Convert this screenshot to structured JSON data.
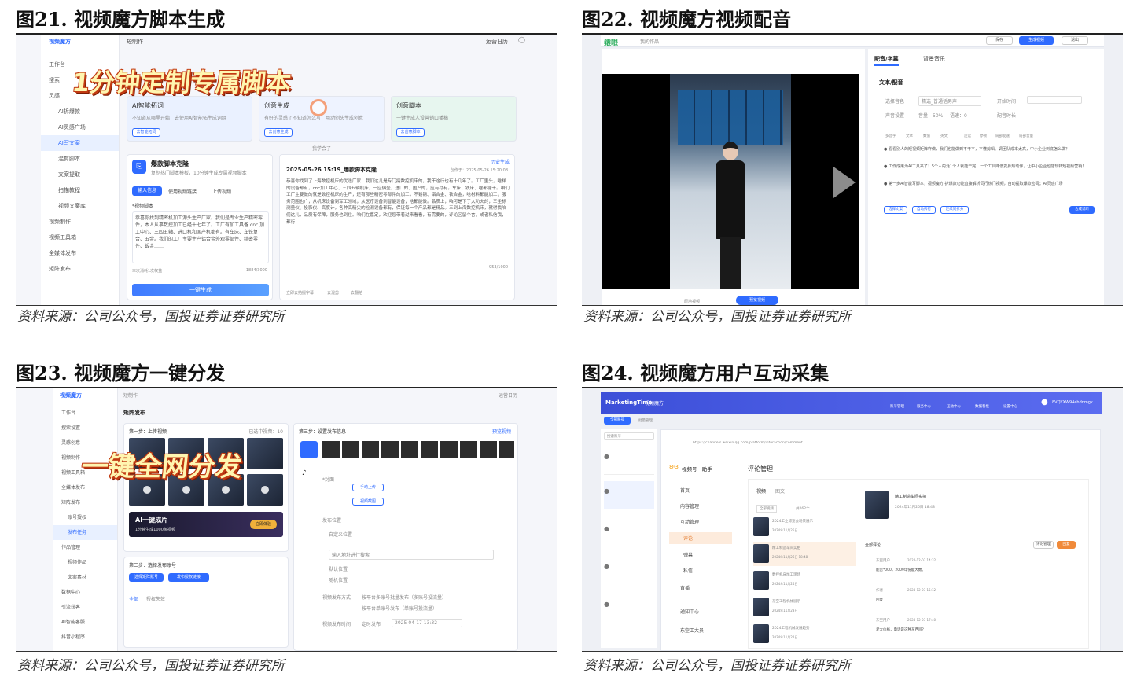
{
  "fig21": {
    "title": "图21. 视频魔方脚本生成",
    "source": "资料来源：公司公众号，国投证券证券研究所",
    "app_name": "视频魔方",
    "breadcrumb": "短制作",
    "top_right": "运营日历",
    "banner": "1分钟定制专属脚本",
    "sidebar": [
      "工作台",
      "搜索",
      "灵感",
      "AI拆爆款",
      "AI灵感广场",
      "AI写文案",
      "混剪脚本",
      "文案提取",
      "扫描教程",
      "视频文案库",
      "视频制作",
      "视频工具箱",
      "全媒体发布",
      "矩阵发布"
    ],
    "cards": [
      {
        "title": "AI智能拓词",
        "desc": "不知道从哪里开始，去使用AI智能拓生成词组",
        "btn": "去智能拓词"
      },
      {
        "title": "创意生成",
        "desc": "有好的灵感了不知道怎么写，用动创头生成创意",
        "btn": "去创意生成"
      },
      {
        "title": "创意脚本",
        "desc": "一键生成人设营销口播稿",
        "btn": "去创意脚本"
      }
    ],
    "learn_link": "我学会了",
    "tool_title": "爆款脚本克隆",
    "tool_desc": "复制热门脚本模板，10分钟生成专属视频脚本",
    "tabs": [
      "输入信息",
      "使用视频链接",
      "上传视频"
    ],
    "field_label": "*视频脚本",
    "input_text": "恭喜你找到精密机加工源头生产厂家。我们是专业生产精密零件，本人从事数控加工已经十七年了。工厂有加工具备 cnc 加工中心、三四五轴、进口机和国产机都有。有车床、车铣复合、五金。我们的工厂主要生产铝合金外观零部件、精密零件、钣金……",
    "count": "1884/3000",
    "hint": "本次消耗1次权益",
    "submit": "一键生成",
    "result_title": "2025-05-26 15:19_爆款脚本克隆",
    "result_time": "创作于：2025-05-26 15:20:08",
    "history": "历史生成",
    "result_text": "恭喜你找到了上海数控机床的优选厂家！我们这儿是专门搞数控机床的，我干这行也有十几年了。工厂里头，啥样的设备都有，cnc加工中心、三四五轴机床，一应俱全，进口的、国产的，应有尽有。车床、铣床、啥都能干。咱们工厂主要做的就是数控机床的生产，还有那些精密零部件的加工，不锈钢、铝合金、铁合金，啥材料都能加工，服务范围也广，从机床设备到军工领域，从医疗设备到智能设备，啥都能做。品质上，咱可是下了大功夫的，三坐标测量仪、投影仪、高度计，各种高精尖的检测设备都有，保证每一个产品都是精品。三到上海数控机床，就得找咱们这儿，品质有保障，服务也到位。咱们在嘉定，欢迎您带着过来看看，有需要的，评论区留个言，或者私信我，都行！",
    "result_count": "953/1000",
    "result_actions": [
      "立即去拍摄字幕",
      "去混剪",
      "去翻拍"
    ]
  },
  "fig22": {
    "title": "图22. 视频魔方视频配音",
    "source": "资料来源：公司公众号，国投证券证券研究所",
    "app_name": "猿眼",
    "my_works": "我的作品",
    "top_buttons": [
      "保存",
      "生成视频",
      "退出"
    ],
    "tabs": [
      "配音/字幕",
      "背景音乐"
    ],
    "section": "文本/配音",
    "labels": [
      "选择音色",
      "开始时间",
      "声音设置",
      "配音时长"
    ],
    "voice_value": "精选_普通话男声",
    "volume": "音量：50%",
    "speed": "语速：0",
    "toolbar": [
      "多音字",
      "文本",
      "数值",
      "英文",
      "连读",
      "停顿",
      "局部变速",
      "局部音量"
    ],
    "text_lines": [
      "● 看看别人的短视频矩阵咋做，我们也能做到不干不，不懂剪辑、调团队成本太高，中小企业到底怎么做？",
      "● 工作成果为AI工具来了！5个人的活1个人就能干完，一个工具降低变身热动作，让中小企业也能玩转短视频营销！",
      "● 第一步AI智能写脚本，视频魔方-拆爆款功能直接解析同行热门视频，自动提取爆款密码；AI灵感广场"
    ],
    "actions": [
      "选择文案",
      "自动拆行",
      "连续同拆分"
    ],
    "compose_btn": "合成试听",
    "video_controls": [
      "原地视频",
      "预览视频"
    ]
  },
  "fig23": {
    "title": "图23. 视频魔方一键分发",
    "source": "资料来源：公司公众号，国投证券证券研究所",
    "app_name": "视频魔方",
    "breadcrumb": "短制作",
    "top_right": "运营日历",
    "banner": "一键全网分发",
    "page_title": "矩阵发布",
    "sidebar": [
      "工作台",
      "搜索设置",
      "灵感创意",
      "视频制作",
      "视频工具箱",
      "全媒体发布",
      "矩阵发布",
      "账号授权",
      "发布任务",
      "作品管理",
      "视频作品",
      "文案素材",
      "数据中心",
      "引流获客",
      "AI智能客服",
      "抖音小程序"
    ],
    "step1": "第一步：上传视频",
    "step1_count": "已选中视频：10",
    "step2": "第二步：选择发布账号",
    "step3": "第三步：设置发布信息",
    "ai_card_title": "AI一键成片",
    "ai_card_desc": "1分钟生成1000条视频",
    "ai_card_btn": "立即体验",
    "account_btns": [
      "选择矩阵账号",
      "发布授权链接"
    ],
    "account_tabs": [
      "全部",
      "授权失效"
    ],
    "cover_label": "*封面",
    "cover_btns": [
      "手动上传",
      "视频截图"
    ],
    "location_label": "发布位置",
    "location_options": [
      "自定义位置",
      "默认位置",
      "随机位置"
    ],
    "location_placeholder": "输入地址进行搜索",
    "method_label": "视频发布方式",
    "methods": [
      "按平台多账号批量发布（多账号投流量）",
      "按平台单账号发布（单账号投流量）"
    ],
    "time_label": "视频发布时间",
    "time_option": "定时发布",
    "time_value": "2025-04-17 13:32",
    "preview": "预览视频"
  },
  "fig24": {
    "title": "图24. 视频魔方用户互动采集",
    "source": "资料来源：公司公众号，国投证券证券研究所",
    "app_name": "MarketingTime",
    "tab_label": "视频魔方",
    "top_nav": [
      "账号管理",
      "服务中心",
      "互动中心",
      "数据看板",
      "设置中心"
    ],
    "user": "8VQYXW94ehdnmgk...",
    "left_buttons": [
      "全部账号",
      "批量管理"
    ],
    "search_placeholder": "搜索账号",
    "browser_url": "https://channels.weixin.qq.com/platform/interaction/comment",
    "brand": "视频号 · 助手",
    "menu": [
      "首页",
      "内容管理",
      "互动管理",
      "评论",
      "弹幕",
      "私信",
      "直播",
      "通知中心",
      "东空工大员"
    ],
    "page_title": "评论管理",
    "tabs": [
      "视频",
      "图文"
    ],
    "filter": "全部视频",
    "filter_count": "共262个",
    "posts": [
      {
        "title": "2024工业博览会场景展示",
        "date": "2024年11月25日"
      },
      {
        "title": "精工制造车间实拍",
        "date": "2024年11月26日 18:48"
      },
      {
        "title": "数控机床加工现场",
        "date": "2024年11月24日"
      },
      {
        "title": "东空工程机械展示",
        "date": "2024年11月23日"
      },
      {
        "title": "2024工程机械发展趋势",
        "date": "2024年11月22日"
      }
    ],
    "selected_post": {
      "title": "精工制造车间实拍",
      "date": "2024年11月26日 18:48"
    },
    "comments_header": "全部评论",
    "comment_btns": [
      "评论管理",
      "回复"
    ],
    "comments": [
      {
        "author": "东空用户",
        "time": "2024-12-03 14:32",
        "text": "能否*000，2009年份能大数。"
      },
      {
        "author": "作者",
        "time": "2024-12-03 15:12",
        "text": "回复"
      },
      {
        "author": "东空用户",
        "time": "2024-12-03 17:40",
        "text": "老大价格，电话是这种东西吗？"
      }
    ]
  }
}
